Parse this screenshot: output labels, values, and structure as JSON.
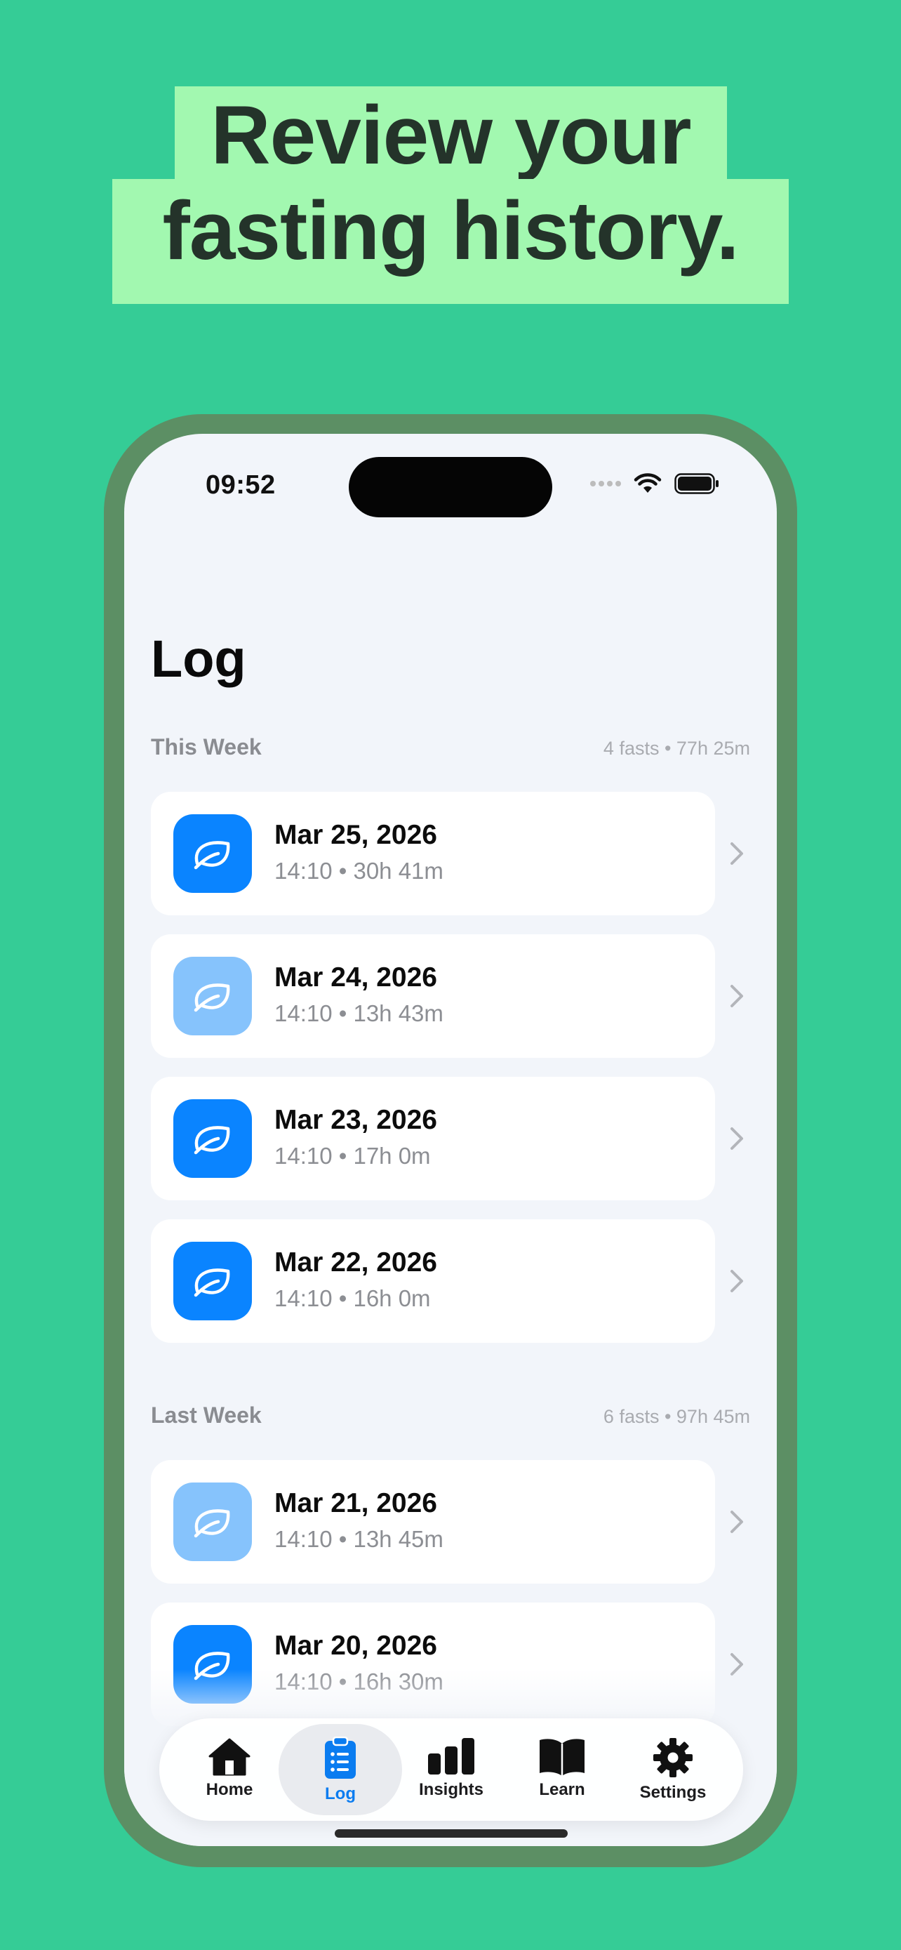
{
  "headline": {
    "line1": "Review your",
    "line2": "fasting history."
  },
  "status_bar": {
    "time": "09:52"
  },
  "page": {
    "title": "Log"
  },
  "sections": [
    {
      "title": "This Week",
      "meta": "4 fasts • 77h 25m",
      "rows": [
        {
          "date": "Mar 25, 2026",
          "detail": "14:10 • 30h 41m",
          "style": "full"
        },
        {
          "date": "Mar 24, 2026",
          "detail": "14:10 • 13h 43m",
          "style": "light"
        },
        {
          "date": "Mar 23, 2026",
          "detail": "14:10 • 17h 0m",
          "style": "full"
        },
        {
          "date": "Mar 22, 2026",
          "detail": "14:10 • 16h 0m",
          "style": "full"
        }
      ]
    },
    {
      "title": "Last Week",
      "meta": "6 fasts • 97h 45m",
      "rows": [
        {
          "date": "Mar 21, 2026",
          "detail": "14:10 • 13h 45m",
          "style": "light"
        },
        {
          "date": "Mar 20, 2026",
          "detail": "14:10 • 16h 30m",
          "style": "full"
        }
      ]
    }
  ],
  "tabs": [
    {
      "label": "Home",
      "icon": "house-icon"
    },
    {
      "label": "Log",
      "icon": "clipboard-list-icon",
      "active": true
    },
    {
      "label": "Insights",
      "icon": "bar-chart-icon"
    },
    {
      "label": "Learn",
      "icon": "open-book-icon"
    },
    {
      "label": "Settings",
      "icon": "gear-icon"
    }
  ],
  "colors": {
    "background": "#35cc96",
    "headline_band": "#a2f8b0",
    "icon_full": "#0a84ff",
    "icon_light": "#86c3fc",
    "accent": "#0a7cf0"
  }
}
